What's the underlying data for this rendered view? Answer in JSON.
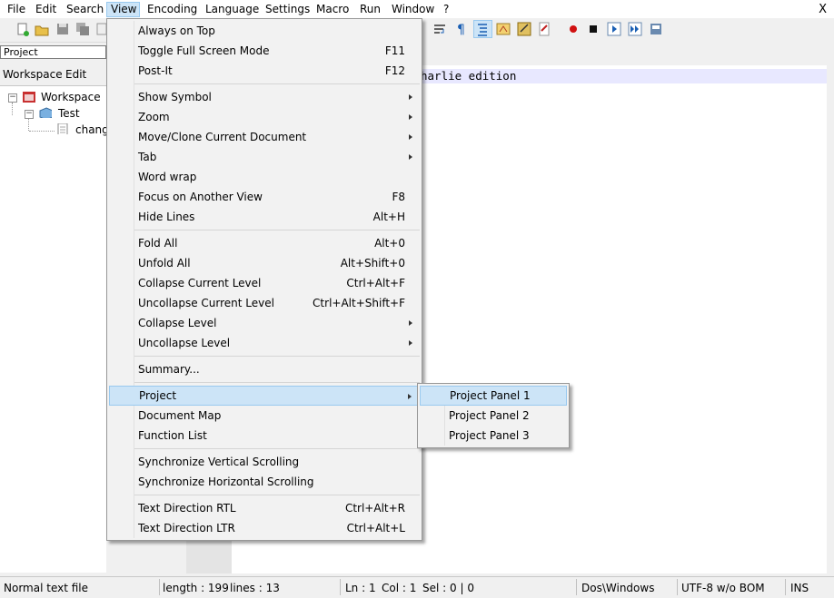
{
  "menubar": {
    "items": [
      "File",
      "Edit",
      "Search",
      "View",
      "Encoding",
      "Language",
      "Settings",
      "Macro",
      "Run",
      "Window",
      "?"
    ],
    "active": "View",
    "close_label": "X"
  },
  "project_panel": {
    "title": "Project",
    "menu": [
      "Workspace",
      "Edit"
    ],
    "tree": {
      "workspace": "Workspace",
      "project": "Test",
      "file": "chang"
    }
  },
  "editor": {
    "visible_text": "harlie edition"
  },
  "view_menu": {
    "items": [
      {
        "label": "Always on Top",
        "shortcut": "",
        "submenu": false
      },
      {
        "label": "Toggle Full Screen Mode",
        "shortcut": "F11",
        "submenu": false
      },
      {
        "label": "Post-It",
        "shortcut": "F12",
        "submenu": false
      },
      {
        "separator": true
      },
      {
        "label": "Show Symbol",
        "shortcut": "",
        "submenu": true
      },
      {
        "label": "Zoom",
        "shortcut": "",
        "submenu": true
      },
      {
        "label": "Move/Clone Current Document",
        "shortcut": "",
        "submenu": true
      },
      {
        "label": "Tab",
        "shortcut": "",
        "submenu": true
      },
      {
        "label": "Word wrap",
        "shortcut": "",
        "submenu": false
      },
      {
        "label": "Focus on Another View",
        "shortcut": "F8",
        "submenu": false
      },
      {
        "label": "Hide Lines",
        "shortcut": "Alt+H",
        "submenu": false
      },
      {
        "separator": true
      },
      {
        "label": "Fold All",
        "shortcut": "Alt+0",
        "submenu": false
      },
      {
        "label": "Unfold All",
        "shortcut": "Alt+Shift+0",
        "submenu": false
      },
      {
        "label": "Collapse Current Level",
        "shortcut": "Ctrl+Alt+F",
        "submenu": false
      },
      {
        "label": "Uncollapse Current Level",
        "shortcut": "Ctrl+Alt+Shift+F",
        "submenu": false
      },
      {
        "label": "Collapse Level",
        "shortcut": "",
        "submenu": true
      },
      {
        "label": "Uncollapse Level",
        "shortcut": "",
        "submenu": true
      },
      {
        "separator": true
      },
      {
        "label": "Summary...",
        "shortcut": "",
        "submenu": false
      },
      {
        "separator": true
      },
      {
        "label": "Project",
        "shortcut": "",
        "submenu": true,
        "highlighted": true
      },
      {
        "label": "Document Map",
        "shortcut": "",
        "submenu": false
      },
      {
        "label": "Function List",
        "shortcut": "",
        "submenu": false
      },
      {
        "separator": true
      },
      {
        "label": "Synchronize Vertical Scrolling",
        "shortcut": "",
        "submenu": false
      },
      {
        "label": "Synchronize Horizontal Scrolling",
        "shortcut": "",
        "submenu": false
      },
      {
        "separator": true
      },
      {
        "label": "Text Direction RTL",
        "shortcut": "Ctrl+Alt+R",
        "submenu": false
      },
      {
        "label": "Text Direction LTR",
        "shortcut": "Ctrl+Alt+L",
        "submenu": false
      }
    ]
  },
  "project_submenu": {
    "items": [
      {
        "label": "Project Panel 1",
        "highlighted": true
      },
      {
        "label": "Project Panel 2"
      },
      {
        "label": "Project Panel 3"
      }
    ]
  },
  "statusbar": {
    "file_type": "Normal text file",
    "length": "length : 199",
    "lines": "lines : 13",
    "ln": "Ln : 1",
    "col": "Col : 1",
    "sel": "Sel : 0 | 0",
    "eol": "Dos\\Windows",
    "encoding": "UTF-8 w/o BOM",
    "mode": "INS"
  },
  "colors": {
    "highlight_bg": "#cce4f7",
    "highlight_border": "#99c9ef",
    "current_line": "#e8e8ff"
  }
}
